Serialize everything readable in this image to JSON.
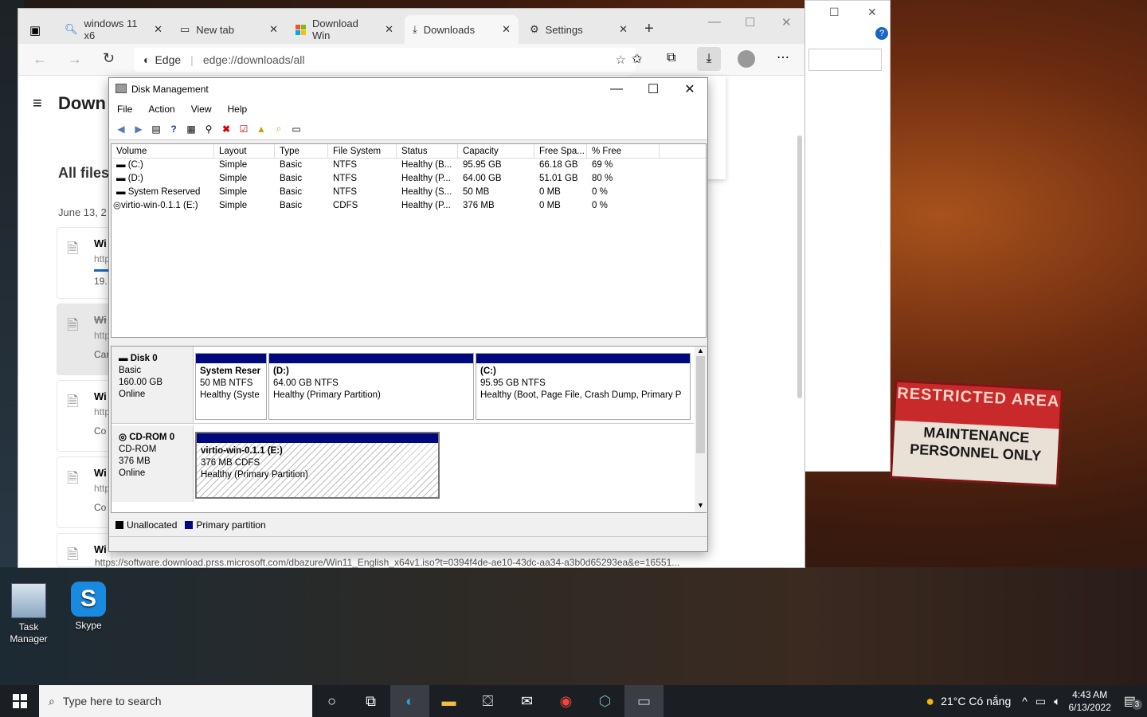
{
  "browser": {
    "tabs": [
      {
        "label": "windows 11 x6",
        "icon": "search-icon"
      },
      {
        "label": "New tab",
        "icon": "tab-icon"
      },
      {
        "label": "Download Win",
        "icon": "windows-logo-icon"
      },
      {
        "label": "Downloads",
        "icon": "download-icon"
      },
      {
        "label": "Settings",
        "icon": "gear-icon"
      }
    ],
    "address_label": "Edge",
    "url": "edge://downloads/all",
    "page_heading": "Down",
    "section_heading": "All files",
    "date_label": "June 13, 2",
    "items": [
      {
        "title": "Wi",
        "sub": "http",
        "extra": "19."
      },
      {
        "title": "Wi",
        "sub": "http",
        "extra": "Car"
      },
      {
        "title": "Wi",
        "sub": "http",
        "extra": "Co"
      },
      {
        "title": "Wi",
        "sub": "http",
        "extra": "Co"
      },
      {
        "title": "Wi",
        "sub": "",
        "extra": ""
      }
    ],
    "footer_url": "https://software.download.prss.microsoft.com/dbazure/Win11_English_x64v1.iso?t=0394f4de-ae10-43dc-aa34-a3b0d65293ea&e=16551..."
  },
  "disk_management": {
    "title": "Disk Management",
    "menu": [
      "File",
      "Action",
      "View",
      "Help"
    ],
    "columns": [
      "Volume",
      "Layout",
      "Type",
      "File System",
      "Status",
      "Capacity",
      "Free Spa...",
      "% Free"
    ],
    "rows": [
      [
        "(C:)",
        "Simple",
        "Basic",
        "NTFS",
        "Healthy (B...",
        "95.95 GB",
        "66.18 GB",
        "69 %"
      ],
      [
        "(D:)",
        "Simple",
        "Basic",
        "NTFS",
        "Healthy (P...",
        "64.00 GB",
        "51.01 GB",
        "80 %"
      ],
      [
        "System Reserved",
        "Simple",
        "Basic",
        "NTFS",
        "Healthy (S...",
        "50 MB",
        "0 MB",
        "0 %"
      ],
      [
        "virtio-win-0.1.1 (E:)",
        "Simple",
        "Basic",
        "CDFS",
        "Healthy (P...",
        "376 MB",
        "0 MB",
        "0 %"
      ]
    ],
    "disk0": {
      "name": "Disk 0",
      "type": "Basic",
      "size": "160.00 GB",
      "state": "Online"
    },
    "disk0_parts": [
      {
        "name": "System Reser",
        "size": "50 MB NTFS",
        "status": "Healthy (Syste"
      },
      {
        "name": "(D:)",
        "size": "64.00 GB NTFS",
        "status": "Healthy (Primary Partition)"
      },
      {
        "name": "(C:)",
        "size": "95.95 GB NTFS",
        "status": "Healthy (Boot, Page File, Crash Dump, Primary P"
      }
    ],
    "cdrom": {
      "name": "CD-ROM 0",
      "type": "CD-ROM",
      "size": "376 MB",
      "state": "Online"
    },
    "cdrom_part": {
      "name": "virtio-win-0.1.1  (E:)",
      "size": "376 MB CDFS",
      "status": "Healthy (Primary Partition)"
    },
    "legend": {
      "unallocated": "Unallocated",
      "primary": "Primary partition"
    },
    "colors": {
      "primary": "#00087e",
      "unallocated": "#000000"
    }
  },
  "sign": {
    "top": "RESTRICTED AREA",
    "bottom": "MAINTENANCE PERSONNEL ONLY"
  },
  "desktop_icons": [
    {
      "label": "Task Manager"
    },
    {
      "label": "Skype"
    }
  ],
  "taskbar": {
    "search_placeholder": "Type here to search",
    "weather": "21°C  Có nắng",
    "time": "4:43 AM",
    "date": "6/13/2022",
    "notification_count": "3"
  }
}
